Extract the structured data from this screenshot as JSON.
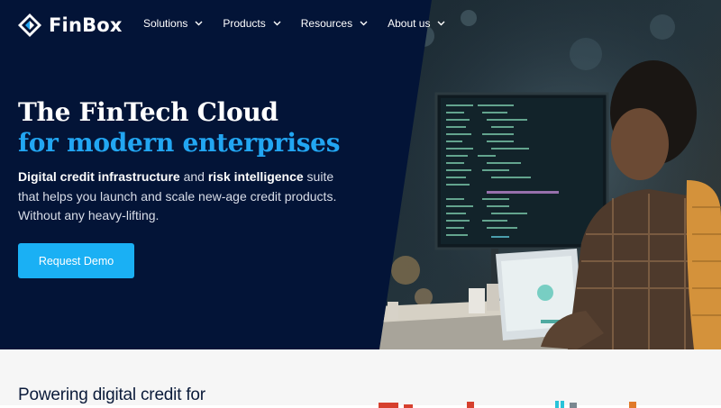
{
  "brand": {
    "name": "FinBox",
    "logo_icon": "diamond-arrows-icon"
  },
  "nav": {
    "items": [
      {
        "label": "Solutions"
      },
      {
        "label": "Products"
      },
      {
        "label": "Resources"
      },
      {
        "label": "About us"
      }
    ]
  },
  "hero": {
    "title_line1": "The FinTech Cloud",
    "title_line2": "for modern enterprises",
    "sub_bold1": "Digital credit infrastructure",
    "sub_text1": " and ",
    "sub_bold2": "risk intelligence",
    "sub_text2": " suite that helps you launch and scale new-age credit products. Without any heavy-lifting.",
    "cta_label": "Request Demo"
  },
  "section": {
    "heading": "Powering digital credit for"
  },
  "colors": {
    "navy": "#031437",
    "accent": "#22a6f2",
    "button": "#1ab0f4"
  }
}
